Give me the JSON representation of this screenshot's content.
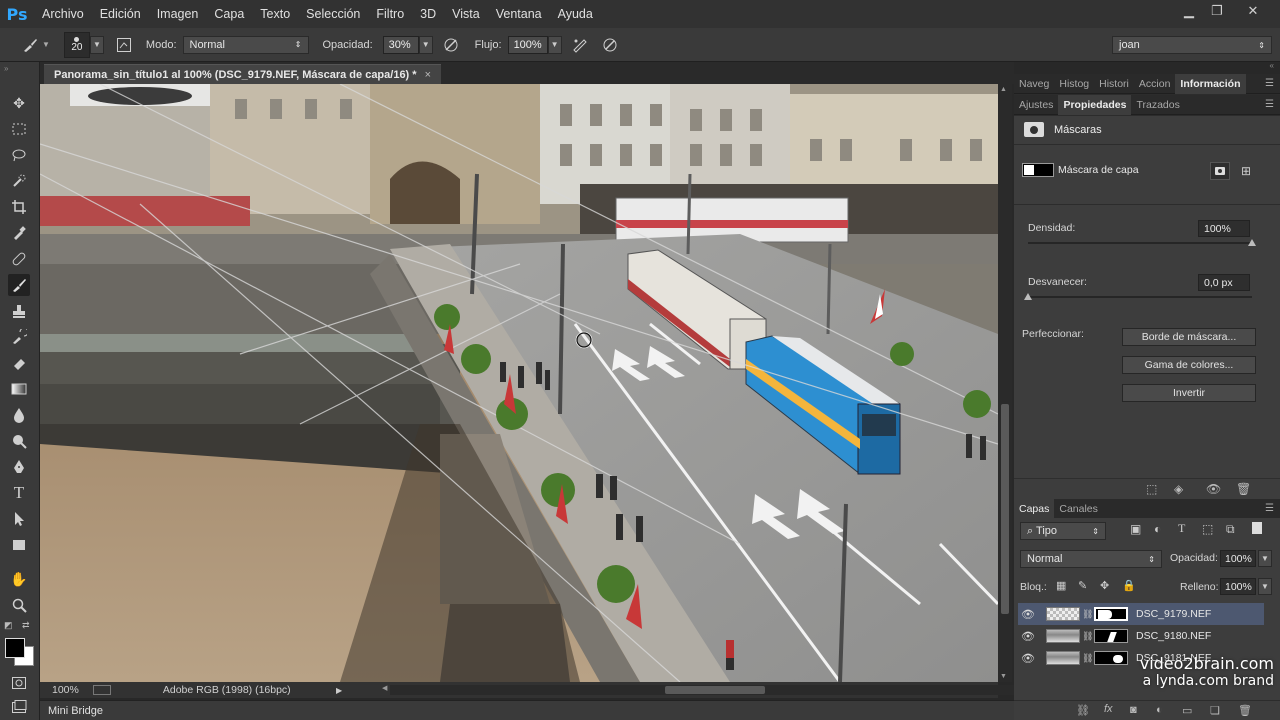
{
  "app": {
    "logo": "Ps",
    "menu": [
      "Archivo",
      "Edición",
      "Imagen",
      "Capa",
      "Texto",
      "Selección",
      "Filtro",
      "3D",
      "Vista",
      "Ventana",
      "Ayuda"
    ],
    "window_controls": [
      "minimize-icon",
      "restore-icon",
      "close-icon"
    ]
  },
  "options_bar": {
    "brush_size": "20",
    "mode_label": "Modo:",
    "mode_value": "Normal",
    "opacity_label": "Opacidad:",
    "opacity_value": "30%",
    "flow_label": "Flujo:",
    "flow_value": "100%",
    "workspace": "joan"
  },
  "document": {
    "tab_title": "Panorama_sin_título1 al 100% (DSC_9179.NEF, Máscara de capa/16) *",
    "close": "×"
  },
  "status": {
    "zoom": "100%",
    "profile": "Adobe RGB (1998) (16bpc)"
  },
  "mini_bridge": "Mini Bridge",
  "panels": {
    "top_tabs": [
      "Naveg",
      "Histog",
      "Histori",
      "Accion",
      "Información"
    ],
    "top_active": 4,
    "mid_tabs": [
      "Ajustes",
      "Propiedades",
      "Trazados"
    ],
    "mid_active": 1,
    "properties": {
      "title": "Máscaras",
      "mask_label": "Máscara de capa",
      "density_label": "Densidad:",
      "density_value": "100%",
      "density": 1.0,
      "feather_label": "Desvanecer:",
      "feather_value": "0,0 px",
      "feather": 0.0,
      "refine_label": "Perfeccionar:",
      "btn_mask_edge": "Borde de máscara...",
      "btn_color_range": "Gama de colores...",
      "btn_invert": "Invertir"
    },
    "layers": {
      "tabs": [
        "Capas",
        "Canales"
      ],
      "active_tab": 0,
      "filter": "Tipo",
      "blend_mode": "Normal",
      "opacity_label": "Opacidad:",
      "opacity_value": "100%",
      "lock_label": "Bloq.:",
      "fill_label": "Relleno:",
      "fill_value": "100%",
      "items": [
        {
          "name": "DSC_9179.NEF",
          "selected": true
        },
        {
          "name": "DSC_9180.NEF",
          "selected": false
        },
        {
          "name": "DSC_9181.NEF",
          "selected": false
        }
      ]
    }
  },
  "watermark": {
    "line1": "video2brain.com",
    "line2": "a lynda.com brand"
  },
  "colors": {
    "accent": "#31a8ff",
    "selected_layer": "#4d5870",
    "panel_bg": "#3d3d3d",
    "app_bg": "#282828"
  }
}
